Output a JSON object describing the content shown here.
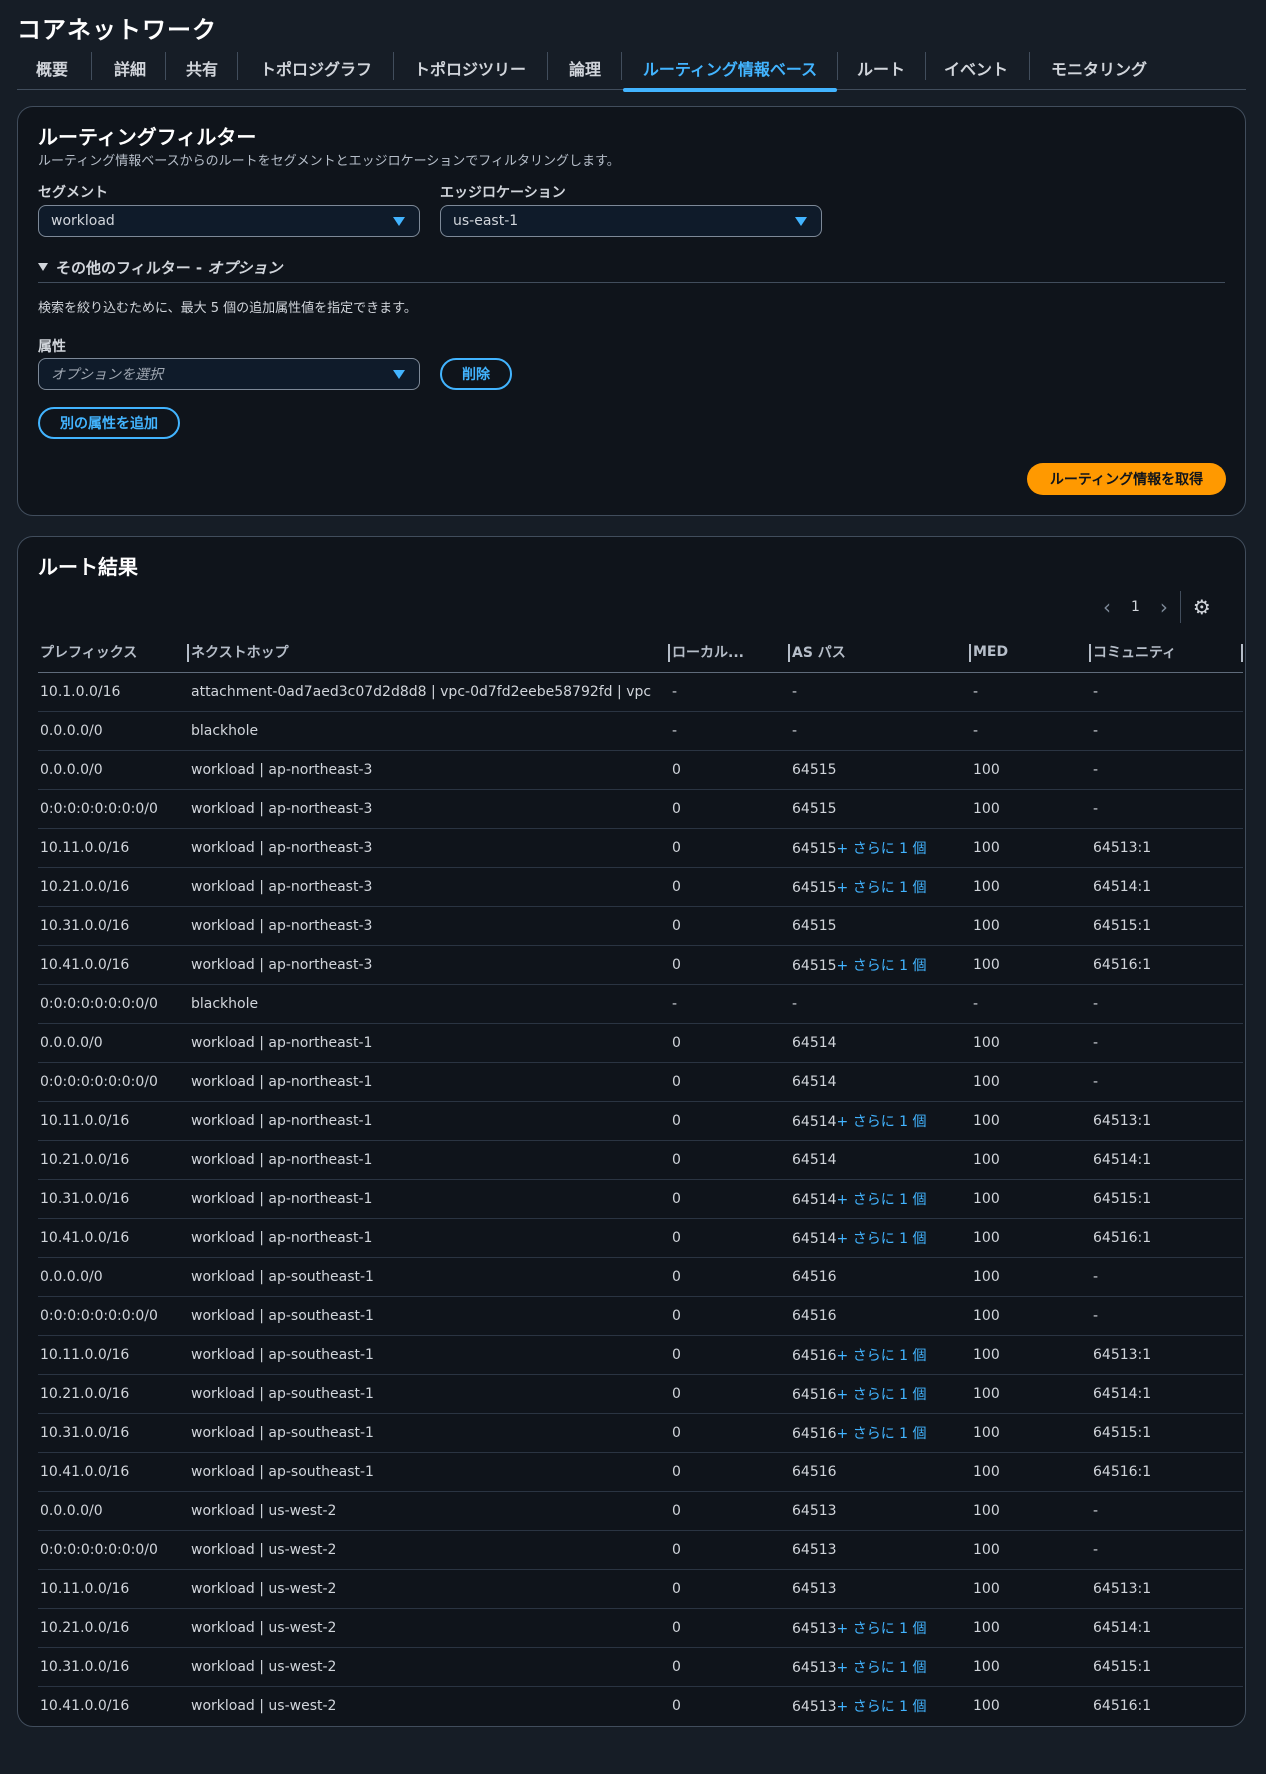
{
  "page": {
    "title": "コアネットワーク"
  },
  "tabs": [
    {
      "label": "概要",
      "active": false
    },
    {
      "label": "詳細",
      "active": false
    },
    {
      "label": "共有",
      "active": false
    },
    {
      "label": "トポロジグラフ",
      "active": false
    },
    {
      "label": "トポロジツリー",
      "active": false
    },
    {
      "label": "論理",
      "active": false
    },
    {
      "label": "ルーティング情報ベース",
      "active": true
    },
    {
      "label": "ルート",
      "active": false
    },
    {
      "label": "イベント",
      "active": false
    },
    {
      "label": "モニタリング",
      "active": false
    }
  ],
  "filter": {
    "title": "ルーティングフィルター",
    "description": "ルーティング情報ベースからのルートをセグメントとエッジロケーションでフィルタリングします。",
    "segment_label": "セグメント",
    "segment_value": "workload",
    "edge_label": "エッジロケーション",
    "edge_value": "us-east-1",
    "more_filters_label": "その他のフィルター - ",
    "more_filters_optional": "オプション",
    "help_text": "検索を絞り込むために、最大 5 個の追加属性値を指定できます。",
    "attribute_label": "属性",
    "attribute_placeholder": "オプションを選択",
    "remove_button": "削除",
    "add_attribute_button": "別の属性を追加",
    "fetch_button": "ルーティング情報を取得"
  },
  "colors": {
    "accent": "#42b4ff",
    "primary_button": "#ff9900",
    "background": "#161d26"
  },
  "results": {
    "title": "ルート結果",
    "page_number": "1",
    "columns": [
      "プレフィックス",
      "ネクストホップ",
      "ローカル...",
      "AS パス",
      "MED",
      "コミュニティ"
    ],
    "more_label": "+ さらに 1 個",
    "rows": [
      {
        "prefix": "10.1.0.0/16",
        "next_hop": "attachment-0ad7aed3c07d2d8d8 | vpc-0d7fd2eebe58792fd | vpc",
        "local": "-",
        "as_path": "-",
        "more": false,
        "med": "-",
        "community": "-"
      },
      {
        "prefix": "0.0.0.0/0",
        "next_hop": "blackhole",
        "local": "-",
        "as_path": "-",
        "more": false,
        "med": "-",
        "community": "-"
      },
      {
        "prefix": "0.0.0.0/0",
        "next_hop": "workload | ap-northeast-3",
        "local": "0",
        "as_path": "64515",
        "more": false,
        "med": "100",
        "community": "-"
      },
      {
        "prefix": "0:0:0:0:0:0:0:0/0",
        "next_hop": "workload | ap-northeast-3",
        "local": "0",
        "as_path": "64515",
        "more": false,
        "med": "100",
        "community": "-"
      },
      {
        "prefix": "10.11.0.0/16",
        "next_hop": "workload | ap-northeast-3",
        "local": "0",
        "as_path": "64515",
        "more": true,
        "med": "100",
        "community": "64513:1"
      },
      {
        "prefix": "10.21.0.0/16",
        "next_hop": "workload | ap-northeast-3",
        "local": "0",
        "as_path": "64515",
        "more": true,
        "med": "100",
        "community": "64514:1"
      },
      {
        "prefix": "10.31.0.0/16",
        "next_hop": "workload | ap-northeast-3",
        "local": "0",
        "as_path": "64515",
        "more": false,
        "med": "100",
        "community": "64515:1"
      },
      {
        "prefix": "10.41.0.0/16",
        "next_hop": "workload | ap-northeast-3",
        "local": "0",
        "as_path": "64515",
        "more": true,
        "med": "100",
        "community": "64516:1"
      },
      {
        "prefix": "0:0:0:0:0:0:0:0/0",
        "next_hop": "blackhole",
        "local": "-",
        "as_path": "-",
        "more": false,
        "med": "-",
        "community": "-"
      },
      {
        "prefix": "0.0.0.0/0",
        "next_hop": "workload | ap-northeast-1",
        "local": "0",
        "as_path": "64514",
        "more": false,
        "med": "100",
        "community": "-"
      },
      {
        "prefix": "0:0:0:0:0:0:0:0/0",
        "next_hop": "workload | ap-northeast-1",
        "local": "0",
        "as_path": "64514",
        "more": false,
        "med": "100",
        "community": "-"
      },
      {
        "prefix": "10.11.0.0/16",
        "next_hop": "workload | ap-northeast-1",
        "local": "0",
        "as_path": "64514",
        "more": true,
        "med": "100",
        "community": "64513:1"
      },
      {
        "prefix": "10.21.0.0/16",
        "next_hop": "workload | ap-northeast-1",
        "local": "0",
        "as_path": "64514",
        "more": false,
        "med": "100",
        "community": "64514:1"
      },
      {
        "prefix": "10.31.0.0/16",
        "next_hop": "workload | ap-northeast-1",
        "local": "0",
        "as_path": "64514",
        "more": true,
        "med": "100",
        "community": "64515:1"
      },
      {
        "prefix": "10.41.0.0/16",
        "next_hop": "workload | ap-northeast-1",
        "local": "0",
        "as_path": "64514",
        "more": true,
        "med": "100",
        "community": "64516:1"
      },
      {
        "prefix": "0.0.0.0/0",
        "next_hop": "workload | ap-southeast-1",
        "local": "0",
        "as_path": "64516",
        "more": false,
        "med": "100",
        "community": "-"
      },
      {
        "prefix": "0:0:0:0:0:0:0:0/0",
        "next_hop": "workload | ap-southeast-1",
        "local": "0",
        "as_path": "64516",
        "more": false,
        "med": "100",
        "community": "-"
      },
      {
        "prefix": "10.11.0.0/16",
        "next_hop": "workload | ap-southeast-1",
        "local": "0",
        "as_path": "64516",
        "more": true,
        "med": "100",
        "community": "64513:1"
      },
      {
        "prefix": "10.21.0.0/16",
        "next_hop": "workload | ap-southeast-1",
        "local": "0",
        "as_path": "64516",
        "more": true,
        "med": "100",
        "community": "64514:1"
      },
      {
        "prefix": "10.31.0.0/16",
        "next_hop": "workload | ap-southeast-1",
        "local": "0",
        "as_path": "64516",
        "more": true,
        "med": "100",
        "community": "64515:1"
      },
      {
        "prefix": "10.41.0.0/16",
        "next_hop": "workload | ap-southeast-1",
        "local": "0",
        "as_path": "64516",
        "more": false,
        "med": "100",
        "community": "64516:1"
      },
      {
        "prefix": "0.0.0.0/0",
        "next_hop": "workload | us-west-2",
        "local": "0",
        "as_path": "64513",
        "more": false,
        "med": "100",
        "community": "-"
      },
      {
        "prefix": "0:0:0:0:0:0:0:0/0",
        "next_hop": "workload | us-west-2",
        "local": "0",
        "as_path": "64513",
        "more": false,
        "med": "100",
        "community": "-"
      },
      {
        "prefix": "10.11.0.0/16",
        "next_hop": "workload | us-west-2",
        "local": "0",
        "as_path": "64513",
        "more": false,
        "med": "100",
        "community": "64513:1"
      },
      {
        "prefix": "10.21.0.0/16",
        "next_hop": "workload | us-west-2",
        "local": "0",
        "as_path": "64513",
        "more": true,
        "med": "100",
        "community": "64514:1"
      },
      {
        "prefix": "10.31.0.0/16",
        "next_hop": "workload | us-west-2",
        "local": "0",
        "as_path": "64513",
        "more": true,
        "med": "100",
        "community": "64515:1"
      },
      {
        "prefix": "10.41.0.0/16",
        "next_hop": "workload | us-west-2",
        "local": "0",
        "as_path": "64513",
        "more": true,
        "med": "100",
        "community": "64516:1"
      }
    ]
  }
}
